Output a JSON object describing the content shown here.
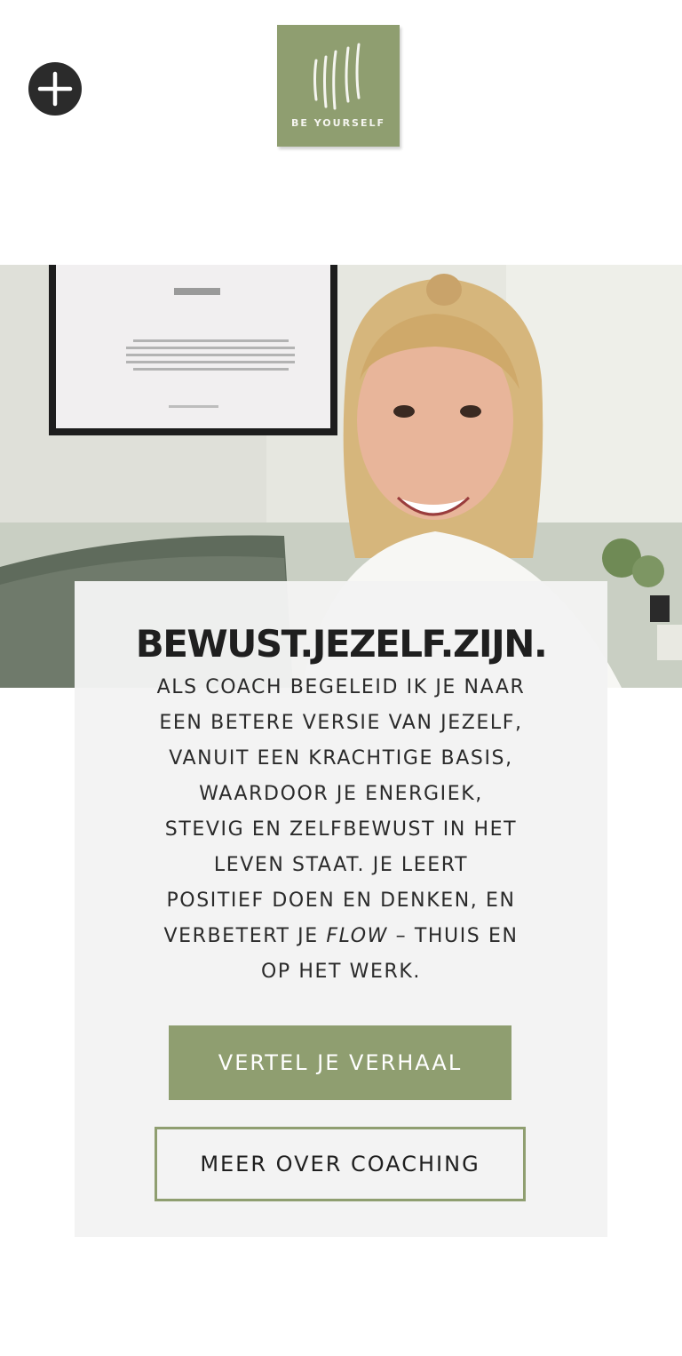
{
  "header": {
    "menu_icon": "plus-icon",
    "logo_text": "BE YOURSELF"
  },
  "hero": {
    "image_alt": "Smiling coach seated on a sofa in front of a framed poster"
  },
  "card": {
    "title": "BEWUST.JEZELF.ZIJN.",
    "body_lines": [
      "ALS COACH BEGELEID IK JE NAAR",
      "EEN BETERE VERSIE VAN JEZELF,",
      "VANUIT EEN KRACHTIGE BASIS,",
      "WAARDOOR JE ENERGIEK,",
      "STEVIG EN ZELFBEWUST IN HET",
      "LEVEN STAAT. JE LEERT",
      "POSITIEF  DOEN EN DENKEN,  EN",
      "VERBETERT JE",
      "FLOW",
      "– THUIS EN",
      "OP HET WERK."
    ],
    "primary_button": "VERTEL JE VERHAAL",
    "secondary_button": "MEER OVER COACHING"
  },
  "colors": {
    "accent": "#8f9e70",
    "dark": "#2b2b2b",
    "card_bg": "#f3f3f3"
  }
}
